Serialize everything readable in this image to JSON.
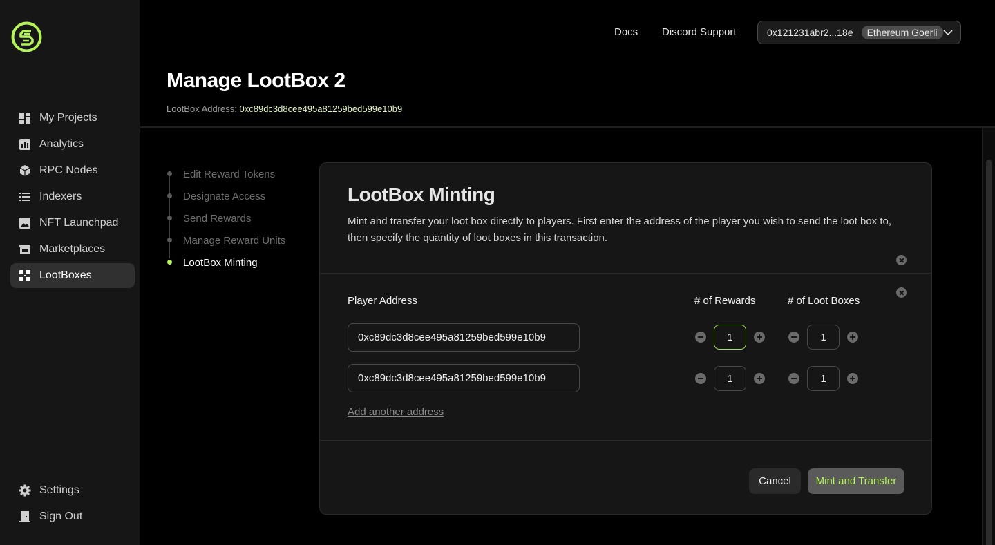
{
  "sidebar": {
    "items": [
      {
        "label": "My Projects",
        "icon": "dashboard-icon"
      },
      {
        "label": "Analytics",
        "icon": "analytics-icon"
      },
      {
        "label": "RPC Nodes",
        "icon": "cube-icon"
      },
      {
        "label": "Indexers",
        "icon": "list-icon"
      },
      {
        "label": "NFT Launchpad",
        "icon": "image-icon"
      },
      {
        "label": "Marketplaces",
        "icon": "store-icon"
      },
      {
        "label": "LootBoxes",
        "icon": "lootbox-icon",
        "active": true
      }
    ],
    "bottom": [
      {
        "label": "Settings",
        "icon": "gear-icon"
      },
      {
        "label": "Sign Out",
        "icon": "sign-out-icon"
      }
    ]
  },
  "topbar": {
    "docs": "Docs",
    "discord": "Discord Support",
    "wallet_address": "0x121231abr2...18e",
    "chain": "Ethereum Goerli"
  },
  "page": {
    "title": "Manage LootBox 2",
    "address_label": "LootBox Address: ",
    "address": "0xc89dc3d8cee495a81259bed599e10b9"
  },
  "steps": [
    {
      "label": "Edit Reward Tokens"
    },
    {
      "label": "Designate Access"
    },
    {
      "label": "Send Rewards"
    },
    {
      "label": "Manage Reward Units"
    },
    {
      "label": "LootBox Minting",
      "active": true
    }
  ],
  "card": {
    "title": "LootBox Minting",
    "description": "Mint and transfer your loot box directly to players. First enter the address of the player you wish to send the loot box to, then specify the quantity of loot boxes in this transaction.",
    "col_player": "Player Address",
    "col_rewards": "# of Rewards",
    "col_lootboxes": "# of Loot Boxes",
    "rows": [
      {
        "address": "0xc89dc3d8cee495a81259bed599e10b9",
        "rewards": "1",
        "lootboxes": "1"
      },
      {
        "address": "0xc89dc3d8cee495a81259bed599e10b9",
        "rewards": "1",
        "lootboxes": "1"
      }
    ],
    "add_link": "Add another address",
    "cancel": "Cancel",
    "submit": "Mint and Transfer"
  },
  "colors": {
    "accent": "#b4f35a",
    "background": "#000000",
    "sidebar": "#161616"
  }
}
